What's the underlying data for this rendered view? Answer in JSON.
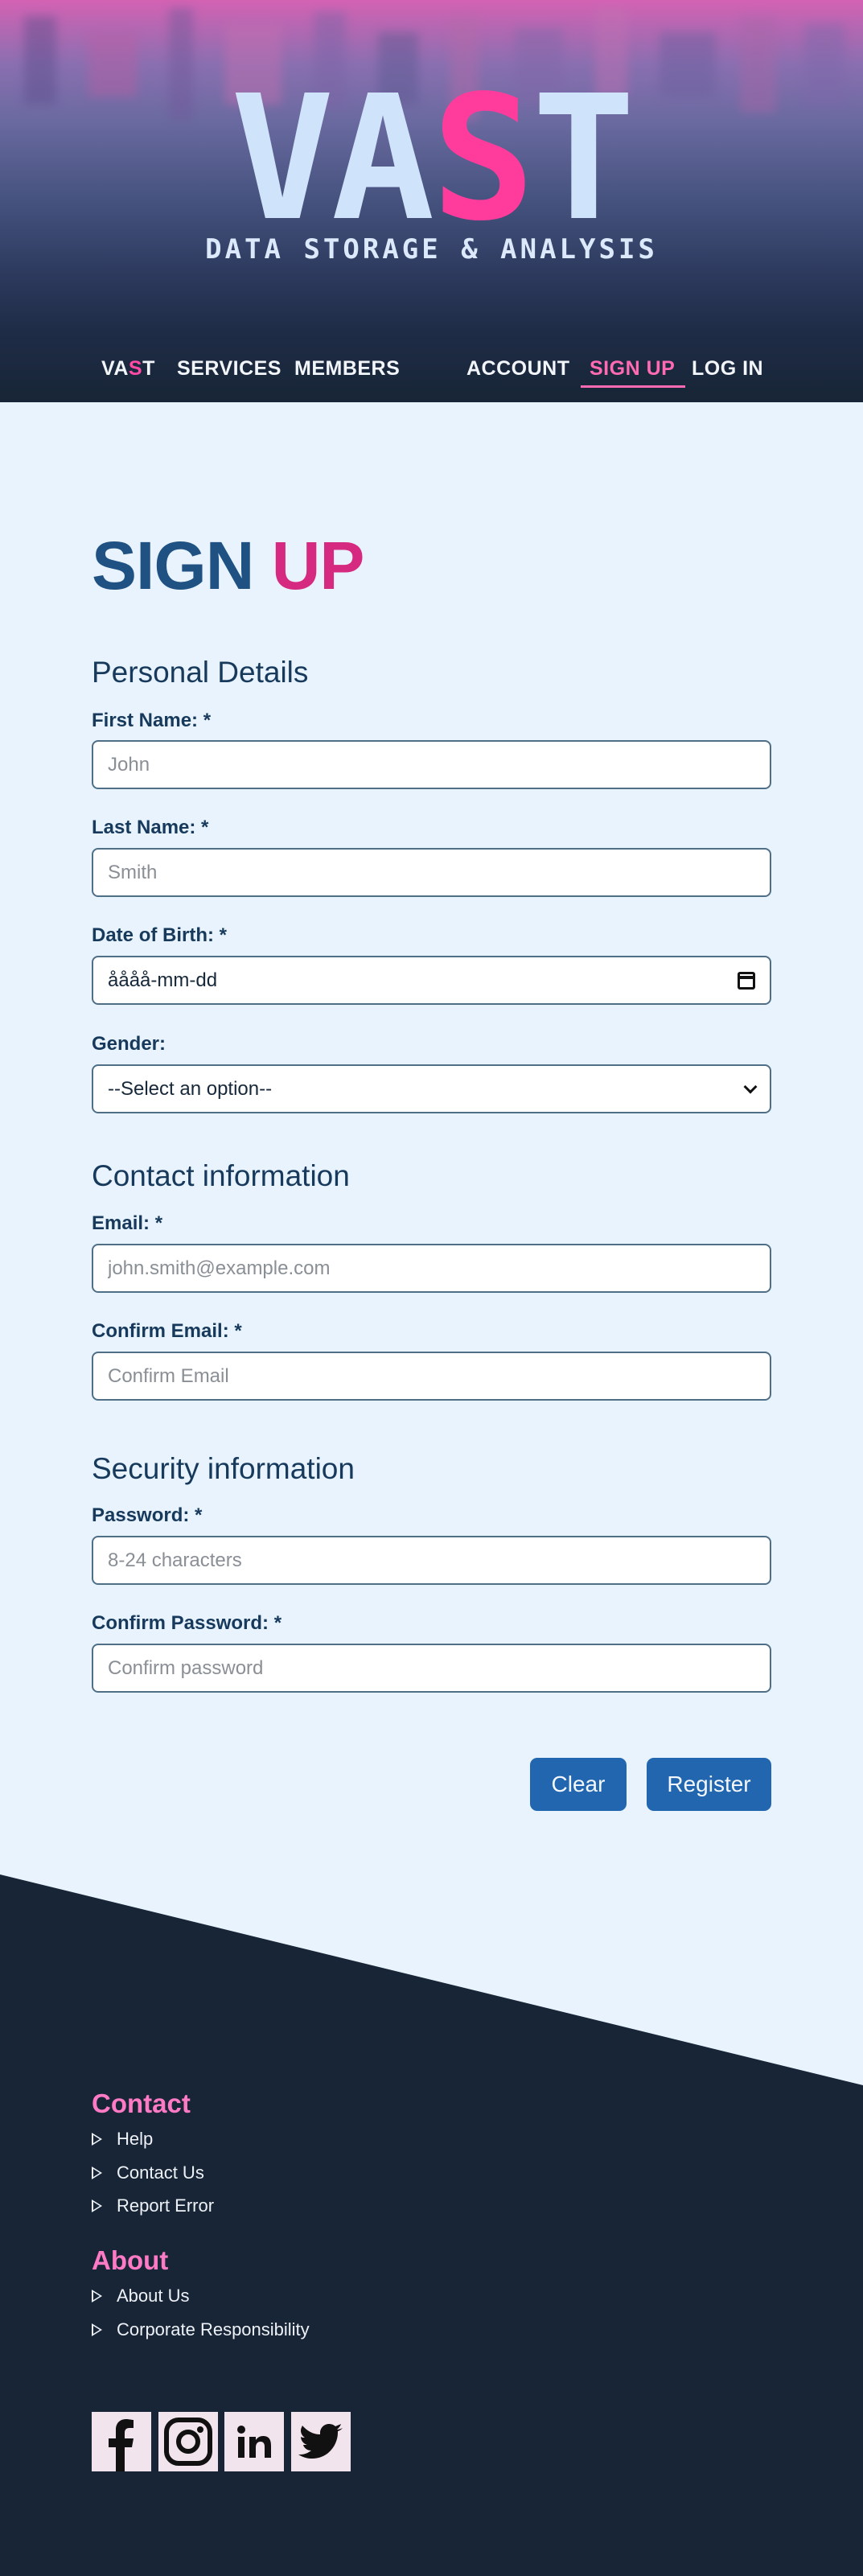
{
  "header": {
    "logo": {
      "part1": "VA",
      "accent": "S",
      "part2": "T"
    },
    "tagline": "DATA STORAGE & ANALYSIS"
  },
  "nav": {
    "brand": {
      "part1": "VA",
      "accent": "S",
      "part2": "T"
    },
    "services": "SERVICES",
    "members": "MEMBERS",
    "account": "ACCOUNT",
    "signup": "SIGN UP",
    "login": "LOG IN",
    "active": "SIGN UP"
  },
  "form": {
    "title_part1": "SIGN",
    "title_part2": "UP",
    "personal": {
      "heading": "Personal Details",
      "first_name_label": "First Name: *",
      "first_name_placeholder": "John",
      "last_name_label": "Last Name: *",
      "last_name_placeholder": "Smith",
      "dob_label": "Date of Birth: *",
      "dob_value": "åååå-mm-dd",
      "gender_label": "Gender:",
      "gender_value": "--Select an option--"
    },
    "contact": {
      "heading": "Contact information",
      "email_label": "Email: *",
      "email_placeholder": "john.smith@example.com",
      "confirm_email_label": "Confirm Email: *",
      "confirm_email_placeholder": "Confirm Email"
    },
    "security": {
      "heading": "Security information",
      "password_label": "Password: *",
      "password_placeholder": "8-24 characters",
      "confirm_password_label": "Confirm Password: *",
      "confirm_password_placeholder": "Confirm password"
    },
    "buttons": {
      "clear": "Clear",
      "register": "Register"
    }
  },
  "footer": {
    "contact_heading": "Contact",
    "contact_links": [
      "Help",
      "Contact Us",
      "Report Error"
    ],
    "about_heading": "About",
    "about_links": [
      "About Us",
      "Corporate Responsibility"
    ],
    "social": [
      "facebook-icon",
      "instagram-icon",
      "linkedin-icon",
      "twitter-icon"
    ]
  },
  "colors": {
    "brand_pink": "#ff3c9c",
    "title_blue": "#1f5283",
    "title_pink": "#d52a80",
    "button_blue": "#2166ae",
    "footer_navy": "#172536",
    "footer_heading_pink": "#ff7ac4",
    "page_bg": "#e8f3fe"
  }
}
